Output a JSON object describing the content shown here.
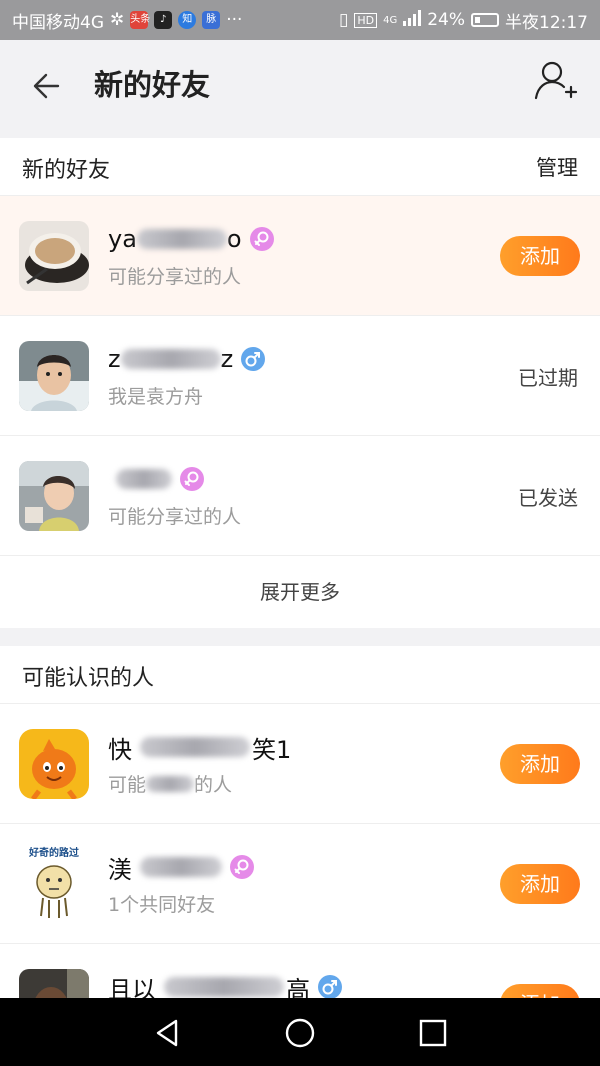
{
  "status_bar": {
    "carrier": "中国移动4G",
    "apps": [
      {
        "label": "头条",
        "color": "#e0443a"
      },
      {
        "label": "♪",
        "color": "#222222"
      },
      {
        "label": "知",
        "color": "#2c7be0"
      },
      {
        "label": "脉",
        "color": "#3a6fd6"
      }
    ],
    "more": "···",
    "network": "4G",
    "hd": "HD",
    "battery": "24%",
    "battery_level": 0.24,
    "time": "半夜12:17"
  },
  "header": {
    "title": "新的好友"
  },
  "new_friends": {
    "title": "新的好友",
    "action": "管理",
    "items": [
      {
        "name": "ya",
        "name_tail": "o",
        "gender": "female",
        "subtitle": "可能分享过的人",
        "action": "添加",
        "action_type": "button"
      },
      {
        "name": "z",
        "name_tail": "z",
        "gender": "male",
        "subtitle": "我是袁方舟",
        "action": "已过期",
        "action_type": "text"
      },
      {
        "name": "",
        "name_tail": "",
        "gender": "female",
        "subtitle": "可能分享过的人",
        "action": "已发送",
        "action_type": "text"
      }
    ],
    "expand_label": "展开更多"
  },
  "maybe_known": {
    "title": "可能认识的人",
    "items": [
      {
        "name": "快",
        "name_tail": "笑1",
        "subtitle": "可能",
        "subtitle_tail": "的人",
        "action": "添加"
      },
      {
        "name": "渼",
        "name_tail": "",
        "gender": "female",
        "subtitle": "1个共同好友",
        "action": "添加",
        "avatar_caption": "好奇的路过"
      },
      {
        "name": "且以",
        "name_tail": "高",
        "gender": "male",
        "action": "添加"
      }
    ]
  },
  "colors": {
    "accent_orange": "#ff8a22",
    "female": "#e58ae8",
    "male": "#62a7ec"
  }
}
